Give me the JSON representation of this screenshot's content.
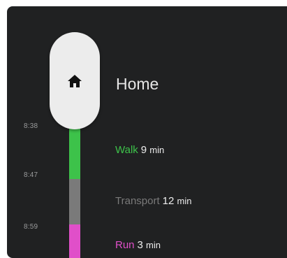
{
  "title": "Home",
  "times": [
    "8:38",
    "8:47",
    "8:59"
  ],
  "legs": [
    {
      "mode": "Walk",
      "duration": "9",
      "unit": "min",
      "color": "#3dc24a"
    },
    {
      "mode": "Transport",
      "duration": "12",
      "unit": "min",
      "color": "#7a7a7a"
    },
    {
      "mode": "Run",
      "duration": "3",
      "unit": "min",
      "color": "#e04fc9"
    }
  ],
  "colors": {
    "background": "#202122",
    "pill": "#ececec",
    "text": "#e6e6e6"
  },
  "icons": {
    "home": "home-icon"
  }
}
